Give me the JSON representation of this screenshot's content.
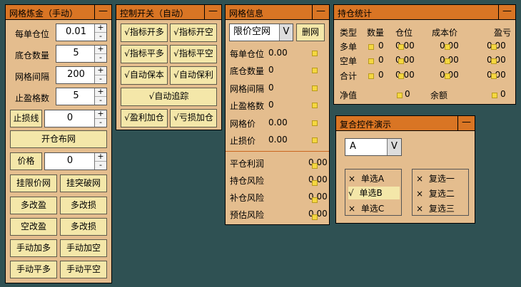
{
  "grid_refine": {
    "title": "网格炼金（手动）",
    "fields": [
      {
        "label": "每单仓位",
        "value": "0.01"
      },
      {
        "label": "底仓数量",
        "value": "5"
      },
      {
        "label": "网格间隔",
        "value": "200"
      },
      {
        "label": "止盈格数",
        "value": "5"
      }
    ],
    "stop_loss_label": "止损线",
    "stop_loss_value": "0",
    "open_grid_button": "开仓布网",
    "price_label": "价格",
    "price_value": "0",
    "buttons": [
      "挂限价网",
      "挂突破网",
      "多改盈",
      "多改损",
      "空改盈",
      "多改损",
      "手动加多",
      "手动加空",
      "手动平多",
      "手动平空"
    ]
  },
  "control": {
    "title": "控制开关（自动）",
    "toggles": [
      "√指标开多",
      "√指标开空",
      "√指标平多",
      "√指标平空",
      "√自动保本",
      "√自动保利"
    ],
    "auto_trail": "√自动追踪",
    "profit_add": "√盈利加仓",
    "loss_add": "√亏损加仓"
  },
  "grid_info": {
    "title": "网格信息",
    "select_value": "限价空网",
    "delete_button": "删网",
    "rows": [
      {
        "label": "每单仓位",
        "value": "0.00"
      },
      {
        "label": "底仓数量",
        "value": "0"
      },
      {
        "label": "网格间隔",
        "value": "0"
      },
      {
        "label": "止盈格数",
        "value": "0"
      },
      {
        "label": "网格价",
        "value": "0.00"
      },
      {
        "label": "止损价",
        "value": "0.00"
      }
    ],
    "risk_rows": [
      {
        "label": "平仓利润",
        "value": "0.00"
      },
      {
        "label": "持仓风险",
        "value": "0.00"
      },
      {
        "label": "补仓风险",
        "value": "0.00"
      },
      {
        "label": "预估风险",
        "value": "0.00"
      }
    ]
  },
  "holdings": {
    "title": "持仓统计",
    "headers": [
      "类型",
      "数量",
      "仓位",
      "成本价",
      "盈亏"
    ],
    "rows": [
      {
        "type": "多单",
        "qty": "0",
        "pos": "0.00",
        "cost": "0.00",
        "pnl": "0.00"
      },
      {
        "type": "空单",
        "qty": "0",
        "pos": "0.00",
        "cost": "0.00",
        "pnl": "0.00"
      },
      {
        "type": "合计",
        "qty": "0",
        "pos": "0.00",
        "cost": "0.00",
        "pnl": "0.00"
      }
    ],
    "net_label": "净值",
    "net_value": "0",
    "balance_label": "余额",
    "balance_value": "0"
  },
  "composite": {
    "title": "复合控件演示",
    "select_value": "A",
    "select_arrow": "V",
    "radios": [
      {
        "mark": "×",
        "label": "单选A"
      },
      {
        "mark": "√",
        "label": "单选B"
      },
      {
        "mark": "×",
        "label": "单选C"
      }
    ],
    "checks": [
      {
        "mark": "×",
        "label": "复选一"
      },
      {
        "mark": "×",
        "label": "复选二"
      },
      {
        "mark": "×",
        "label": "复选三"
      }
    ]
  },
  "common": {
    "minimize": "—",
    "spin_up": "+",
    "spin_down": "-",
    "select_arrow": "V"
  },
  "colors": {
    "background": "#2f5153",
    "panel": "#e4bd8e",
    "titlebar": "#d97524",
    "button": "#f4e7a9",
    "icon": "#f5d740"
  }
}
